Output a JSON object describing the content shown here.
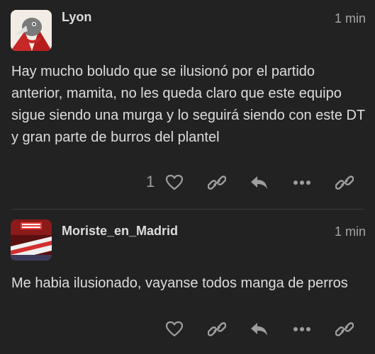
{
  "posts": [
    {
      "username": "Lyon",
      "time": "1 min",
      "body": "Hay mucho boludo que se ilusionó por el partido anterior, mamita, no les queda claro que este equipo sigue siendo una murga y lo seguirá siendo con este DT y gran parte de burros del plantel",
      "like_count": "1",
      "avatar_icon": "bird-mascot-avatar"
    },
    {
      "username": "Moriste_en_Madrid",
      "time": "1 min",
      "body": "Me habia ilusionado, vayanse todos manga de perros",
      "like_count": "",
      "avatar_icon": "stadium-banner-avatar"
    }
  ],
  "actions": [
    "heart-icon",
    "link-icon",
    "reply-icon",
    "more-icon",
    "share-link-icon"
  ],
  "colors": {
    "background": "#222222",
    "text": "#dddddd",
    "muted": "#9e9e9e"
  }
}
